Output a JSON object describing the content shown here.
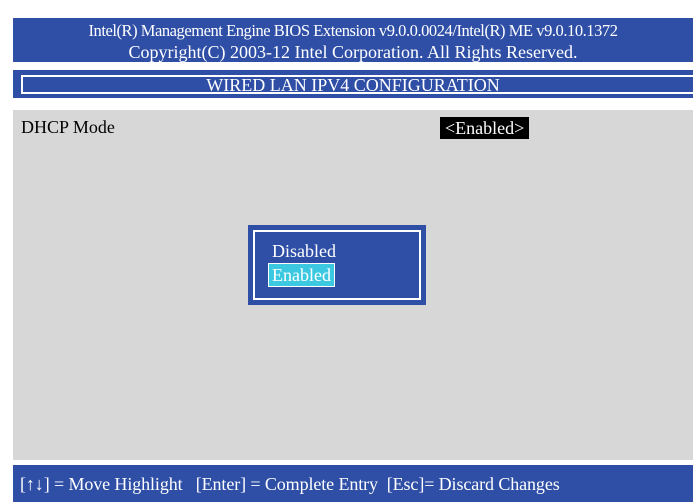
{
  "header": {
    "line1": "Intel(R) Management Engine BIOS Extension v9.0.0.0024/Intel(R) ME v9.0.10.1372",
    "line2": "Copyright(C) 2003-12 Intel Corporation. All Rights Reserved."
  },
  "title": "WIRED LAN IPV4 CONFIGURATION",
  "settings": [
    {
      "label": "DHCP Mode",
      "value": "<Enabled>"
    }
  ],
  "popup": {
    "options": [
      "Disabled",
      "Enabled"
    ],
    "selected": "Enabled"
  },
  "footer": {
    "help": "[↑↓] = Move Highlight   [Enter] = Complete Entry  [Esc]= Discard Changes"
  },
  "colors": {
    "panel_blue": "#2f4fa6",
    "content_gray": "#d7d7d7",
    "highlight_cyan": "#3cc8e0"
  }
}
